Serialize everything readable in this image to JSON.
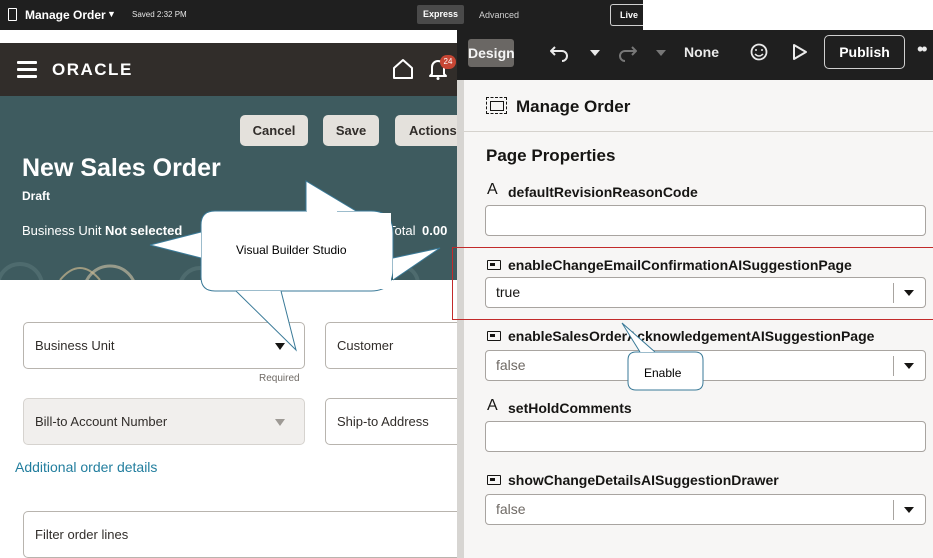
{
  "topbar": {
    "title": "Manage Order",
    "saved": "Saved 2:32 PM",
    "mode_express": "Express",
    "mode_advanced": "Advanced",
    "live": "Live"
  },
  "app": {
    "logo": "ORACLE",
    "notification_count": "24",
    "buttons": {
      "cancel": "Cancel",
      "save": "Save",
      "actions": "Actions"
    },
    "order_title": "New Sales Order",
    "order_status": "Draft",
    "business_unit_label": "Business Unit",
    "business_unit_value": "Not selected",
    "total_label": "Total",
    "total_value": "0.00",
    "fields": {
      "business_unit": "Business Unit",
      "required": "Required",
      "customer": "Customer",
      "bill_to": "Bill-to Account Number",
      "ship_to": "Ship-to Address",
      "additional_details": "Additional order details",
      "filter_lines": "Filter order lines"
    }
  },
  "vb": {
    "design": "Design",
    "none": "None",
    "publish": "Publish",
    "panel_title": "Manage Order",
    "section_title": "Page Properties",
    "properties": [
      {
        "label": "defaultRevisionReasonCode",
        "value": ""
      },
      {
        "label": "enableChangeEmailConfirmationAISuggestionPage",
        "value": "true"
      },
      {
        "label": "enableSalesOrderAcknowledgementAISuggestionPage",
        "value": "false"
      },
      {
        "label": "setHoldComments",
        "value": ""
      },
      {
        "label": "showChangeDetailsAISuggestionDrawer",
        "value": "false"
      }
    ]
  },
  "callouts": {
    "vbs": "Visual Builder Studio",
    "enable": "Enable"
  },
  "colors": {
    "banner": "#3e5b5f",
    "header": "#312d2a",
    "link": "#227e9e",
    "badge": "#c74634",
    "highlight": "#c22a2a"
  }
}
